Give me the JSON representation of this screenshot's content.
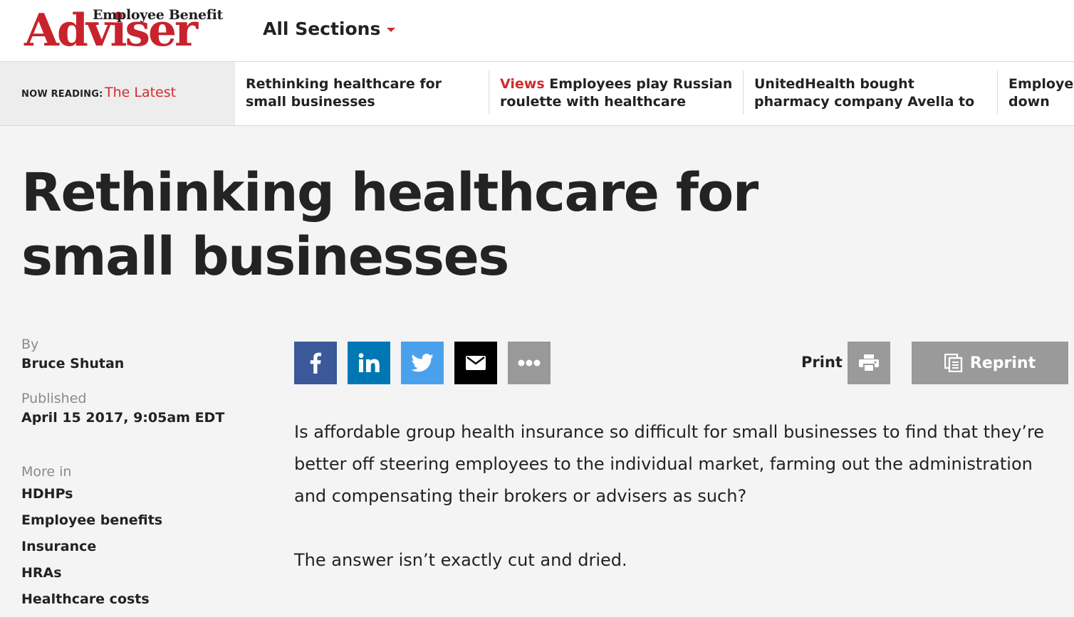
{
  "brand": {
    "logo_small": "Employee Benefit",
    "logo_big": "Adviser",
    "primary_color": "#c8232c",
    "accent_color": "#d12c2c"
  },
  "nav": {
    "all_sections_label": "All Sections"
  },
  "now_reading": {
    "label": "NOW READING:",
    "value": "The Latest",
    "stories": [
      {
        "tag": "",
        "title": "Rethinking healthcare for small businesses"
      },
      {
        "tag": "Views",
        "title": "Employees play Russian roulette with healthcare choices"
      },
      {
        "tag": "",
        "title": "UnitedHealth bought pharmacy company Avella to build …"
      },
      {
        "tag": "",
        "title": "Employers down bar"
      }
    ]
  },
  "article": {
    "headline": "Rethinking healthcare for small businesses",
    "by_label": "By",
    "author": "Bruce Shutan",
    "published_label": "Published",
    "published_date": "April 15 2017, 9:05am EDT",
    "more_in_label": "More in",
    "more_in": [
      "HDHPs",
      "Employee benefits",
      "Insurance",
      "HRAs",
      "Healthcare costs"
    ],
    "paragraphs": [
      "Is affordable group health insurance so difficult for small businesses to find that they’re better off steering employees to the individual market, farming out the administration and compensating their brokers or advisers as such?",
      "The answer isn’t exactly cut and dried."
    ]
  },
  "share": {
    "print_label": "Print",
    "reprint_label": "Reprint",
    "icons": [
      "facebook-icon",
      "linkedin-icon",
      "twitter-icon",
      "email-icon",
      "more-icon",
      "printer-icon",
      "reprint-icon"
    ]
  }
}
